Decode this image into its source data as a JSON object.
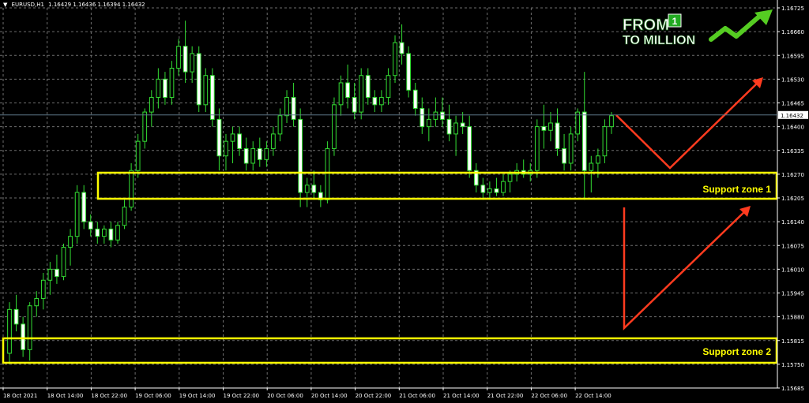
{
  "header": {
    "symbol": "EURUSD,H1",
    "ohlc": "1.16429 1.16436 1.16394 1.16432"
  },
  "logo": {
    "line1": "FROM",
    "line2": "TO MILLION",
    "badge": "1",
    "colors": {
      "text": "#ffffff",
      "badge": "#22aa22",
      "arrow": "#55cc22"
    }
  },
  "colors": {
    "background": "#000000",
    "grid": "#6e6e6e",
    "candle": "#33dd33",
    "bull_body": "#000000",
    "bear_body": "#ffffff",
    "zone": "#ffff00",
    "arrow": "#ff3b1f",
    "price_line": "#5f7a8a"
  },
  "chart_data": {
    "type": "candlestick",
    "title": "EURUSD,H1",
    "ylim": [
      1.15685,
      1.16725
    ],
    "yticks": [
      "1.16725",
      "1.16660",
      "1.16595",
      "1.16530",
      "1.16465",
      "1.16400",
      "1.16335",
      "1.16270",
      "1.16205",
      "1.16140",
      "1.16075",
      "1.16010",
      "1.15945",
      "1.15880",
      "1.15815",
      "1.15750",
      "1.15685"
    ],
    "xticks": [
      "18 Oct 2021",
      "18 Oct 14:00",
      "18 Oct 22:00",
      "19 Oct 06:00",
      "19 Oct 14:00",
      "19 Oct 22:00",
      "20 Oct 06:00",
      "20 Oct 14:00",
      "20 Oct 22:00",
      "21 Oct 06:00",
      "21 Oct 14:00",
      "21 Oct 22:00",
      "22 Oct 06:00",
      "22 Oct 14:00"
    ],
    "current_price": "1.16432",
    "candles": [
      [
        1.1578,
        1.1592,
        1.1575,
        1.159
      ],
      [
        1.159,
        1.1594,
        1.1584,
        1.1586
      ],
      [
        1.1586,
        1.1588,
        1.1577,
        1.1579
      ],
      [
        1.1579,
        1.1592,
        1.1576,
        1.1591
      ],
      [
        1.1591,
        1.1595,
        1.1588,
        1.1593
      ],
      [
        1.1593,
        1.16,
        1.159,
        1.1598
      ],
      [
        1.1598,
        1.1603,
        1.1594,
        1.1601
      ],
      [
        1.1601,
        1.1605,
        1.1597,
        1.1599
      ],
      [
        1.1599,
        1.1608,
        1.1598,
        1.1607
      ],
      [
        1.1607,
        1.1612,
        1.1602,
        1.161
      ],
      [
        1.161,
        1.1624,
        1.1608,
        1.1622
      ],
      [
        1.1622,
        1.1624,
        1.1612,
        1.1614
      ],
      [
        1.1614,
        1.1616,
        1.161,
        1.1612
      ],
      [
        1.1612,
        1.1614,
        1.1608,
        1.161
      ],
      [
        1.161,
        1.1613,
        1.1608,
        1.1612
      ],
      [
        1.1612,
        1.1614,
        1.1607,
        1.1609
      ],
      [
        1.1609,
        1.1614,
        1.1608,
        1.1613
      ],
      [
        1.1613,
        1.162,
        1.1612,
        1.1618
      ],
      [
        1.1618,
        1.163,
        1.1617,
        1.1628
      ],
      [
        1.1628,
        1.1638,
        1.1626,
        1.1636
      ],
      [
        1.1636,
        1.1645,
        1.1634,
        1.1644
      ],
      [
        1.1644,
        1.165,
        1.164,
        1.1648
      ],
      [
        1.1648,
        1.1656,
        1.1645,
        1.1653
      ],
      [
        1.1653,
        1.1655,
        1.1646,
        1.1648
      ],
      [
        1.1648,
        1.1658,
        1.1646,
        1.1656
      ],
      [
        1.1656,
        1.1664,
        1.1654,
        1.1662
      ],
      [
        1.1662,
        1.1669,
        1.1652,
        1.1655
      ],
      [
        1.1655,
        1.1662,
        1.1652,
        1.166
      ],
      [
        1.166,
        1.1662,
        1.1644,
        1.1646
      ],
      [
        1.1646,
        1.1656,
        1.1644,
        1.1654
      ],
      [
        1.1654,
        1.1656,
        1.164,
        1.1642
      ],
      [
        1.1642,
        1.1645,
        1.1628,
        1.1632
      ],
      [
        1.1632,
        1.1638,
        1.1628,
        1.1636
      ],
      [
        1.1636,
        1.164,
        1.163,
        1.1638
      ],
      [
        1.1638,
        1.164,
        1.1632,
        1.1634
      ],
      [
        1.1634,
        1.1637,
        1.1628,
        1.163
      ],
      [
        1.163,
        1.1636,
        1.1628,
        1.1634
      ],
      [
        1.1634,
        1.1637,
        1.1629,
        1.1631
      ],
      [
        1.1631,
        1.1636,
        1.1629,
        1.1634
      ],
      [
        1.1634,
        1.164,
        1.1632,
        1.1638
      ],
      [
        1.1638,
        1.1645,
        1.1636,
        1.1643
      ],
      [
        1.1643,
        1.165,
        1.1641,
        1.1648
      ],
      [
        1.1648,
        1.1652,
        1.164,
        1.1642
      ],
      [
        1.1642,
        1.1645,
        1.1618,
        1.1622
      ],
      [
        1.1622,
        1.1626,
        1.1618,
        1.1624
      ],
      [
        1.1624,
        1.1628,
        1.162,
        1.1622
      ],
      [
        1.1622,
        1.1624,
        1.1618,
        1.162
      ],
      [
        1.162,
        1.1636,
        1.1619,
        1.1634
      ],
      [
        1.1634,
        1.1648,
        1.1632,
        1.1646
      ],
      [
        1.1646,
        1.1654,
        1.1643,
        1.1652
      ],
      [
        1.1652,
        1.1657,
        1.1645,
        1.1648
      ],
      [
        1.1648,
        1.1652,
        1.1642,
        1.1644
      ],
      [
        1.1644,
        1.1656,
        1.1642,
        1.1654
      ],
      [
        1.1654,
        1.1656,
        1.1646,
        1.1648
      ],
      [
        1.1648,
        1.165,
        1.1644,
        1.1646
      ],
      [
        1.1646,
        1.165,
        1.1644,
        1.1648
      ],
      [
        1.1648,
        1.1656,
        1.1646,
        1.1654
      ],
      [
        1.1654,
        1.1665,
        1.1652,
        1.1663
      ],
      [
        1.1663,
        1.1668,
        1.1657,
        1.166
      ],
      [
        1.166,
        1.1662,
        1.1648,
        1.165
      ],
      [
        1.165,
        1.1652,
        1.1643,
        1.1645
      ],
      [
        1.1645,
        1.1648,
        1.1638,
        1.164
      ],
      [
        1.164,
        1.1645,
        1.1636,
        1.1642
      ],
      [
        1.1642,
        1.1648,
        1.164,
        1.1644
      ],
      [
        1.1644,
        1.1648,
        1.164,
        1.1642
      ],
      [
        1.1642,
        1.1646,
        1.1636,
        1.1638
      ],
      [
        1.1638,
        1.1643,
        1.1632,
        1.1641
      ],
      [
        1.1641,
        1.1644,
        1.1638,
        1.164
      ],
      [
        1.164,
        1.1643,
        1.1626,
        1.1628
      ],
      [
        1.1628,
        1.163,
        1.1622,
        1.1624
      ],
      [
        1.1624,
        1.1626,
        1.162,
        1.1622
      ],
      [
        1.1622,
        1.1625,
        1.162,
        1.1623
      ],
      [
        1.1623,
        1.1626,
        1.1621,
        1.1622
      ],
      [
        1.1622,
        1.1627,
        1.1621,
        1.1625
      ],
      [
        1.1625,
        1.1628,
        1.1622,
        1.1627
      ],
      [
        1.1627,
        1.163,
        1.1625,
        1.1628
      ],
      [
        1.1628,
        1.1631,
        1.1626,
        1.1627
      ],
      [
        1.1627,
        1.163,
        1.1625,
        1.1628
      ],
      [
        1.1628,
        1.1642,
        1.1626,
        1.164
      ],
      [
        1.164,
        1.1646,
        1.1634,
        1.1639
      ],
      [
        1.1639,
        1.1644,
        1.1636,
        1.1641
      ],
      [
        1.1641,
        1.1645,
        1.1632,
        1.1634
      ],
      [
        1.1634,
        1.1638,
        1.1628,
        1.163
      ],
      [
        1.163,
        1.164,
        1.1628,
        1.1638
      ],
      [
        1.1638,
        1.1645,
        1.1636,
        1.1644
      ],
      [
        1.1644,
        1.1655,
        1.162,
        1.1628
      ],
      [
        1.1628,
        1.1632,
        1.1622,
        1.163
      ],
      [
        1.163,
        1.1634,
        1.1626,
        1.1632
      ],
      [
        1.1632,
        1.1642,
        1.163,
        1.164
      ],
      [
        1.164,
        1.1644,
        1.1638,
        1.1643
      ]
    ]
  },
  "annotations": {
    "zone1_label": "Support zone 1",
    "zone2_label": "Support zone 2"
  }
}
